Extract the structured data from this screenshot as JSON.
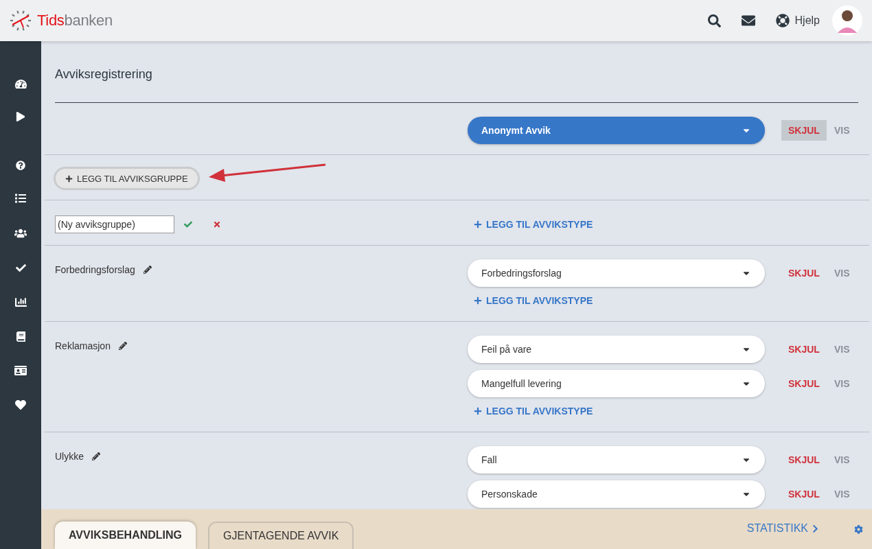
{
  "header": {
    "logo": {
      "text_1": "Tids",
      "text_2": "banken"
    },
    "help": "Hjelp"
  },
  "page": {
    "title": "Avviksregistrering"
  },
  "anonymous": {
    "value": "Anonymt Avvik",
    "visibility": [
      {
        "label": "SKJUL",
        "kind": "hide",
        "selected": true
      },
      {
        "label": "VIS",
        "kind": "show",
        "selected": false
      }
    ]
  },
  "add_group_button": "LEGG TIL AVVIKSGRUPPE",
  "new_group": {
    "value": "(Ny avviksgruppe)",
    "add_type": "LEGG TIL AVVIKSTYPE"
  },
  "groups": [
    {
      "name": "Forbedringsforslag",
      "add_type": "LEGG TIL AVVIKSTYPE",
      "types": [
        {
          "value": "Forbedringsforslag",
          "visibility": [
            {
              "label": "SKJUL",
              "kind": "hide",
              "selected": false
            },
            {
              "label": "VIS",
              "kind": "show",
              "selected": false
            }
          ]
        }
      ]
    },
    {
      "name": "Reklamasjon",
      "add_type": "LEGG TIL AVVIKSTYPE",
      "types": [
        {
          "value": "Feil på vare",
          "visibility": [
            {
              "label": "SKJUL",
              "kind": "hide",
              "selected": false
            },
            {
              "label": "VIS",
              "kind": "show",
              "selected": false
            }
          ]
        },
        {
          "value": "Mangelfull levering",
          "visibility": [
            {
              "label": "SKJUL",
              "kind": "hide",
              "selected": false
            },
            {
              "label": "VIS",
              "kind": "show",
              "selected": false
            }
          ]
        }
      ]
    },
    {
      "name": "Ulykke",
      "types": [
        {
          "value": "Fall",
          "visibility": [
            {
              "label": "SKJUL",
              "kind": "hide",
              "selected": false
            },
            {
              "label": "VIS",
              "kind": "show",
              "selected": false
            }
          ]
        },
        {
          "value": "Personskade",
          "visibility": [
            {
              "label": "SKJUL",
              "kind": "hide",
              "selected": false
            },
            {
              "label": "VIS",
              "kind": "show",
              "selected": false
            }
          ]
        }
      ]
    }
  ],
  "footer": {
    "tabs": [
      {
        "label": "AVVIKSBEHANDLING",
        "selected": true
      },
      {
        "label": "GJENTAGENDE AVVIK",
        "selected": false
      }
    ],
    "stats_link": "STATISTIKK"
  }
}
